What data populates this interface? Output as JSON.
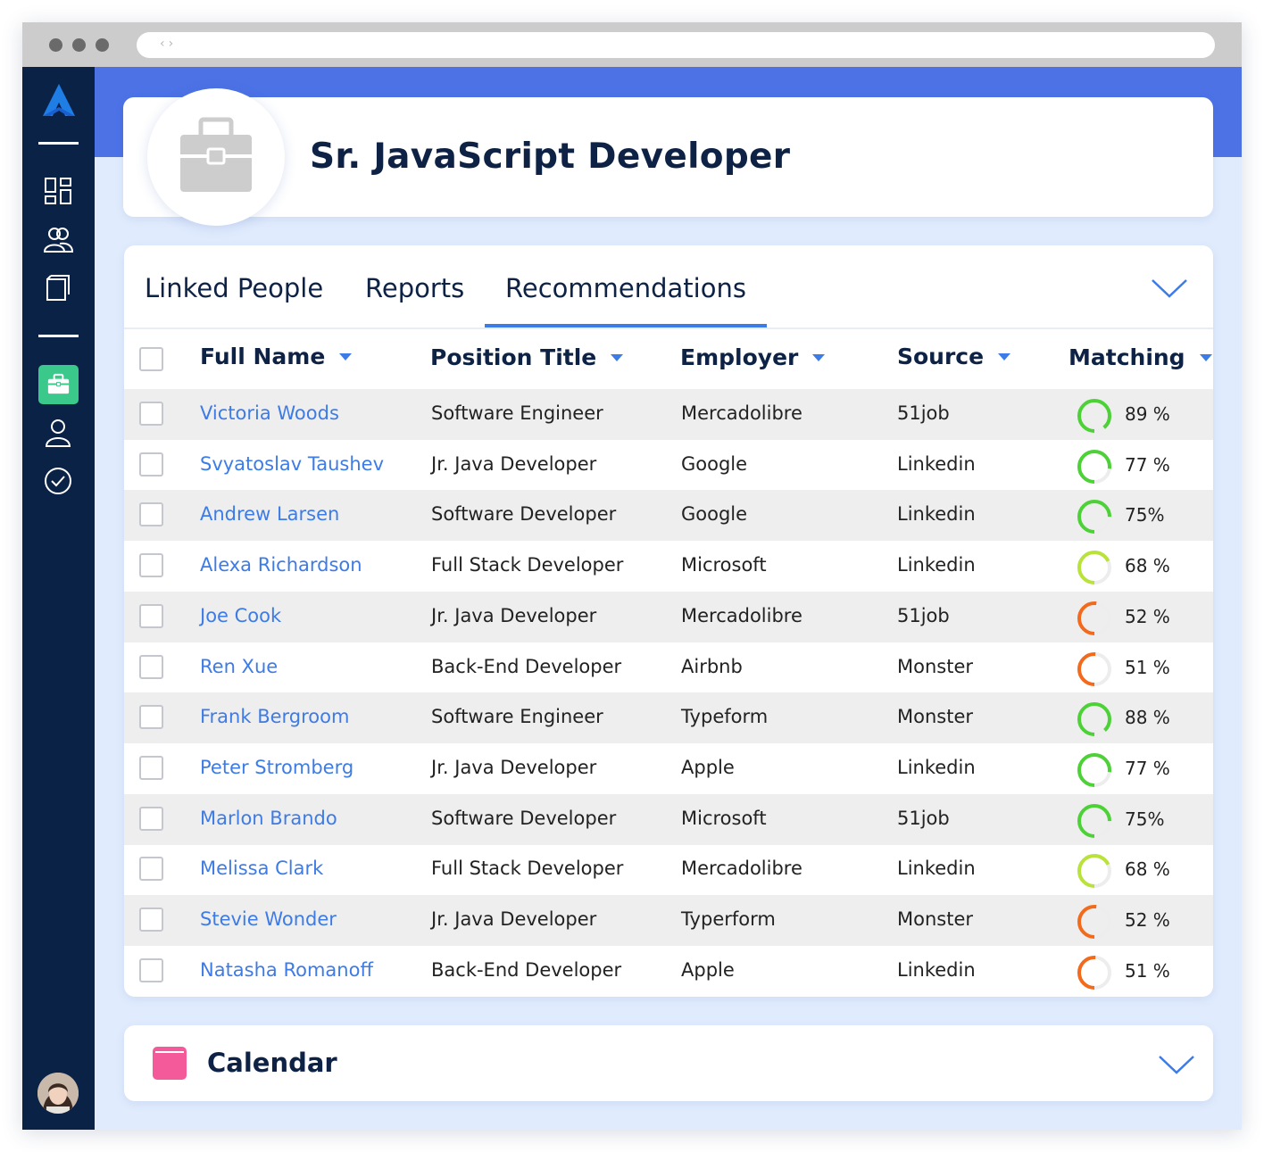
{
  "job": {
    "title": "Sr. JavaScript Developer"
  },
  "tabs": [
    {
      "label": "Linked People",
      "active": false
    },
    {
      "label": "Reports",
      "active": false
    },
    {
      "label": "Recommendations",
      "active": true
    }
  ],
  "columns": [
    {
      "label": "Full Name"
    },
    {
      "label": "Position Title"
    },
    {
      "label": "Employer"
    },
    {
      "label": "Source"
    },
    {
      "label": "Matching"
    }
  ],
  "rows": [
    {
      "name": "Victoria Woods",
      "position": "Software Engineer",
      "employer": "Mercadolibre",
      "source": "51job",
      "match_label": "89 %",
      "match": 89
    },
    {
      "name": "Svyatoslav Taushev",
      "position": "Jr. Java Developer",
      "employer": "Google",
      "source": "Linkedin",
      "match_label": "77 %",
      "match": 77
    },
    {
      "name": "Andrew Larsen",
      "position": "Software Developer",
      "employer": "Google",
      "source": "Linkedin",
      "match_label": "75%",
      "match": 75
    },
    {
      "name": "Alexa Richardson",
      "position": "Full Stack Developer",
      "employer": "Microsoft",
      "source": "Linkedin",
      "match_label": "68 %",
      "match": 68
    },
    {
      "name": "Joe Cook",
      "position": "Jr. Java Developer",
      "employer": "Mercadolibre",
      "source": "51job",
      "match_label": "52 %",
      "match": 52
    },
    {
      "name": "Ren Xue",
      "position": "Back-End Developer",
      "employer": "Airbnb",
      "source": "Monster",
      "match_label": "51 %",
      "match": 51
    },
    {
      "name": "Frank Bergroom",
      "position": "Software Engineer",
      "employer": "Typeform",
      "source": "Monster",
      "match_label": "88 %",
      "match": 88
    },
    {
      "name": "Peter Stromberg",
      "position": "Jr. Java Developer",
      "employer": "Apple",
      "source": "Linkedin",
      "match_label": "77 %",
      "match": 77
    },
    {
      "name": "Marlon Brando",
      "position": "Software Developer",
      "employer": "Microsoft",
      "source": "51job",
      "match_label": "75%",
      "match": 75
    },
    {
      "name": "Melissa Clark",
      "position": "Full Stack Developer",
      "employer": "Mercadolibre",
      "source": "Linkedin",
      "match_label": "68 %",
      "match": 68
    },
    {
      "name": "Stevie Wonder",
      "position": "Jr. Java Developer",
      "employer": "Typerform",
      "source": "Monster",
      "match_label": "52 %",
      "match": 52
    },
    {
      "name": "Natasha Romanoff",
      "position": "Back-End Developer",
      "employer": "Apple",
      "source": "Linkedin",
      "match_label": "51 %",
      "match": 51
    }
  ],
  "calendar": {
    "title": "Calendar"
  },
  "colors": {
    "brand_blue": "#4c72e6",
    "sidebar": "#0a2246",
    "active_nav": "#3ac98a",
    "link": "#3d7be6",
    "match_high": "#4cd137",
    "match_mid": "#b9e23a",
    "match_low": "#f26b1d",
    "calendar_icon": "#f45a9a"
  },
  "icons": {
    "logo": "logo-icon",
    "nav": [
      "dashboard-icon",
      "people-icon",
      "documents-icon",
      "briefcase-icon",
      "user-icon",
      "check-circle-icon"
    ],
    "job": "briefcase-icon",
    "expand": "chevron-down-icon",
    "calendar": "calendar-icon"
  }
}
